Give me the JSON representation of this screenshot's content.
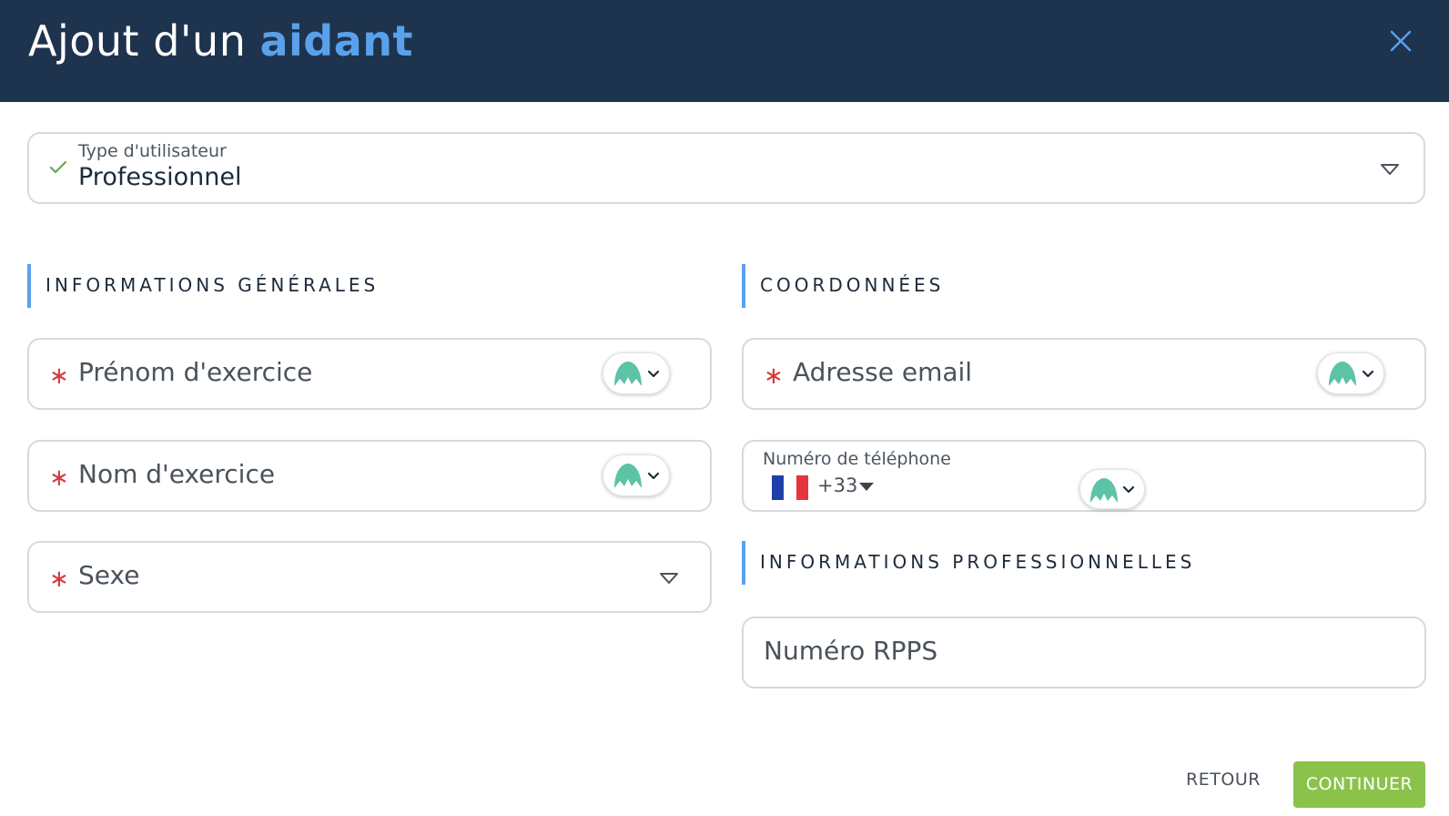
{
  "header": {
    "title_prefix": "Ajout d'un ",
    "title_accent": "aidant"
  },
  "user_type": {
    "label": "Type d'utilisateur",
    "value": "Professionnel"
  },
  "sections": {
    "general": "INFORMATIONS GÉNÉRALES",
    "contact": "COORDONNÉES",
    "professional": "INFORMATIONS PROFESSIONNELLES"
  },
  "fields": {
    "first_name": {
      "placeholder": "Prénom d'exercice",
      "required_mark": "∗"
    },
    "last_name": {
      "placeholder": "Nom d'exercice",
      "required_mark": "∗"
    },
    "sex": {
      "placeholder": "Sexe",
      "required_mark": "∗"
    },
    "email": {
      "placeholder": "Adresse email",
      "required_mark": "∗"
    },
    "phone": {
      "label": "Numéro de téléphone",
      "country_code": "+33"
    },
    "rpps": {
      "placeholder": "Numéro RPPS"
    }
  },
  "buttons": {
    "back": "RETOUR",
    "continue": "CONTINUER"
  },
  "colors": {
    "header_bg": "#1e334d",
    "accent": "#5aa1ec",
    "continue_bg": "#8bc34a",
    "required": "#d43b3b",
    "check": "#6aa84f",
    "extension_icon": "#5cc3a6"
  },
  "icons": {
    "close": "close-icon",
    "check": "check-icon",
    "dropdown": "dropdown-arrow-icon",
    "extension": "password-manager-icon",
    "flag": "france-flag-icon"
  }
}
